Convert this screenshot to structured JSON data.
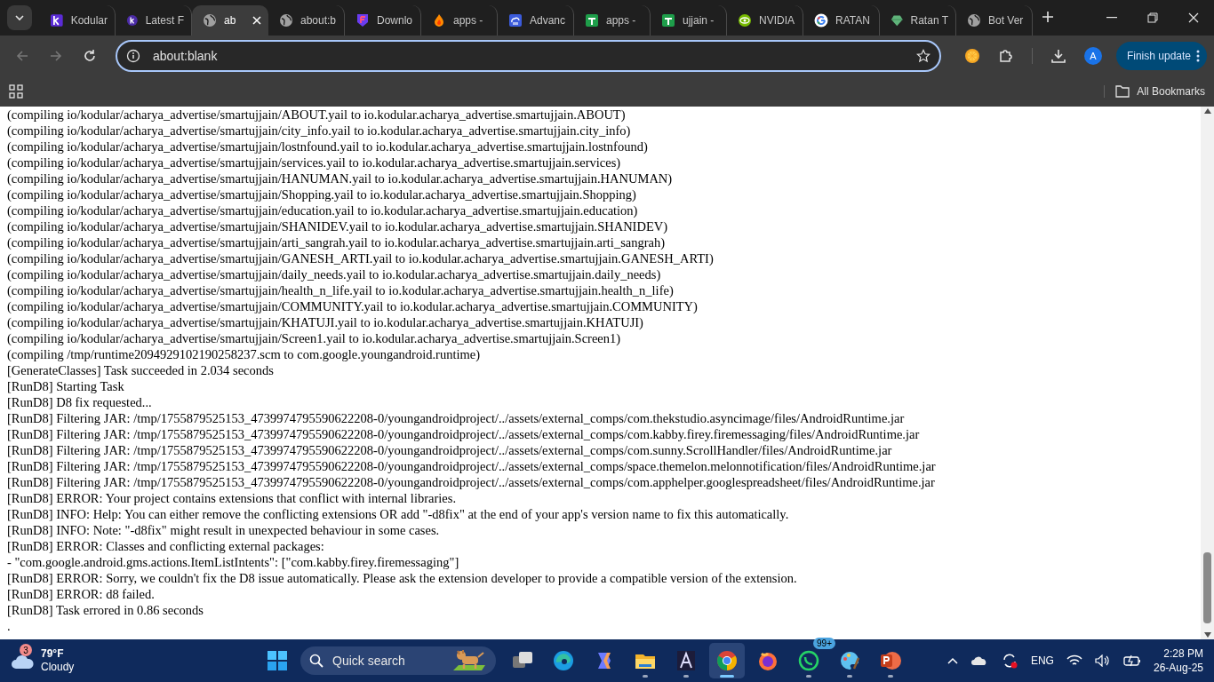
{
  "tabs": [
    {
      "label": "Kodular",
      "kind": "kodular",
      "selected": false
    },
    {
      "label": "Latest F",
      "kind": "kodular-round",
      "selected": false
    },
    {
      "label": "ab",
      "kind": "globe",
      "selected": true
    },
    {
      "label": "about:b",
      "kind": "globe",
      "selected": false
    },
    {
      "label": "Downlo",
      "kind": "shield",
      "selected": false
    },
    {
      "label": "apps -",
      "kind": "flame",
      "selected": false
    },
    {
      "label": "Advanc",
      "kind": "cloud",
      "selected": false
    },
    {
      "label": "apps -",
      "kind": "sheet",
      "selected": false
    },
    {
      "label": "ujjain -",
      "kind": "sheet",
      "selected": false
    },
    {
      "label": "NVIDIA",
      "kind": "eye",
      "selected": false
    },
    {
      "label": "RATAN",
      "kind": "google",
      "selected": false
    },
    {
      "label": "Ratan T",
      "kind": "gem",
      "selected": false
    },
    {
      "label": "Bot Ver",
      "kind": "globe",
      "selected": false
    }
  ],
  "address_bar": {
    "value": "about:blank"
  },
  "update_button": "Finish update",
  "profile_initial": "A",
  "bookmarks": {
    "label": "All Bookmarks"
  },
  "log_lines": [
    "(compiling io/kodular/acharya_advertise/smartujjain/ABOUT.yail to io.kodular.acharya_advertise.smartujjain.ABOUT)",
    "(compiling io/kodular/acharya_advertise/smartujjain/city_info.yail to io.kodular.acharya_advertise.smartujjain.city_info)",
    "(compiling io/kodular/acharya_advertise/smartujjain/lostnfound.yail to io.kodular.acharya_advertise.smartujjain.lostnfound)",
    "(compiling io/kodular/acharya_advertise/smartujjain/services.yail to io.kodular.acharya_advertise.smartujjain.services)",
    "(compiling io/kodular/acharya_advertise/smartujjain/HANUMAN.yail to io.kodular.acharya_advertise.smartujjain.HANUMAN)",
    "(compiling io/kodular/acharya_advertise/smartujjain/Shopping.yail to io.kodular.acharya_advertise.smartujjain.Shopping)",
    "(compiling io/kodular/acharya_advertise/smartujjain/education.yail to io.kodular.acharya_advertise.smartujjain.education)",
    "(compiling io/kodular/acharya_advertise/smartujjain/SHANIDEV.yail to io.kodular.acharya_advertise.smartujjain.SHANIDEV)",
    "(compiling io/kodular/acharya_advertise/smartujjain/arti_sangrah.yail to io.kodular.acharya_advertise.smartujjain.arti_sangrah)",
    "(compiling io/kodular/acharya_advertise/smartujjain/GANESH_ARTI.yail to io.kodular.acharya_advertise.smartujjain.GANESH_ARTI)",
    "(compiling io/kodular/acharya_advertise/smartujjain/daily_needs.yail to io.kodular.acharya_advertise.smartujjain.daily_needs)",
    "(compiling io/kodular/acharya_advertise/smartujjain/health_n_life.yail to io.kodular.acharya_advertise.smartujjain.health_n_life)",
    "(compiling io/kodular/acharya_advertise/smartujjain/COMMUNITY.yail to io.kodular.acharya_advertise.smartujjain.COMMUNITY)",
    "(compiling io/kodular/acharya_advertise/smartujjain/KHATUJI.yail to io.kodular.acharya_advertise.smartujjain.KHATUJI)",
    "(compiling io/kodular/acharya_advertise/smartujjain/Screen1.yail to io.kodular.acharya_advertise.smartujjain.Screen1)",
    "(compiling /tmp/runtime2094929102190258237.scm to com.google.youngandroid.runtime)",
    "[GenerateClasses] Task succeeded in 2.034 seconds",
    "[RunD8] Starting Task",
    "[RunD8] D8 fix requested...",
    "[RunD8] Filtering JAR: /tmp/1755879525153_4739974795590622208-0/youngandroidproject/../assets/external_comps/com.thekstudio.asyncimage/files/AndroidRuntime.jar",
    "[RunD8] Filtering JAR: /tmp/1755879525153_4739974795590622208-0/youngandroidproject/../assets/external_comps/com.kabby.firey.firemessaging/files/AndroidRuntime.jar",
    "[RunD8] Filtering JAR: /tmp/1755879525153_4739974795590622208-0/youngandroidproject/../assets/external_comps/com.sunny.ScrollHandler/files/AndroidRuntime.jar",
    "[RunD8] Filtering JAR: /tmp/1755879525153_4739974795590622208-0/youngandroidproject/../assets/external_comps/space.themelon.melonnotification/files/AndroidRuntime.jar",
    "[RunD8] Filtering JAR: /tmp/1755879525153_4739974795590622208-0/youngandroidproject/../assets/external_comps/com.apphelper.googlespreadsheet/files/AndroidRuntime.jar",
    "[RunD8] ERROR: Your project contains extensions that conflict with internal libraries.",
    "[RunD8] INFO: Help: You can either remove the conflicting extensions OR add \"-d8fix\" at the end of your app's version name to fix this automatically.",
    "[RunD8] INFO: Note: \"-d8fix\" might result in unexpected behaviour in some cases.",
    "[RunD8] ERROR: Classes and conflicting external packages:",
    "- \"com.google.android.gms.actions.ItemListIntents\": [\"com.kabby.firey.firemessaging\"]",
    "[RunD8] ERROR: Sorry, we couldn't fix the D8 issue automatically. Please ask the extension developer to provide a compatible version of the extension.",
    "[RunD8] ERROR: d8 failed.",
    "[RunD8] Task errored in 0.86 seconds",
    "."
  ],
  "weather": {
    "badge": "3",
    "temperature": "79°F",
    "condition": "Cloudy"
  },
  "search": {
    "placeholder": "Quick search"
  },
  "taskbar_apps": [
    {
      "kind": "task-view",
      "running": false,
      "selected": false
    },
    {
      "kind": "edge",
      "running": false,
      "selected": false
    },
    {
      "kind": "copilot",
      "running": false,
      "selected": false
    },
    {
      "kind": "explorer",
      "running": true,
      "selected": false
    },
    {
      "kind": "acrobat",
      "running": true,
      "selected": false
    },
    {
      "kind": "chrome",
      "running": true,
      "selected": true
    },
    {
      "kind": "firefox",
      "running": false,
      "selected": false
    },
    {
      "kind": "whatsapp",
      "running": true,
      "selected": false,
      "badge": "99+"
    },
    {
      "kind": "paint",
      "running": true,
      "selected": false
    },
    {
      "kind": "powerpoint",
      "running": true,
      "selected": false
    }
  ],
  "tray": {
    "language": "ENG",
    "time": "2:28 PM",
    "date": "26-Aug-25"
  }
}
